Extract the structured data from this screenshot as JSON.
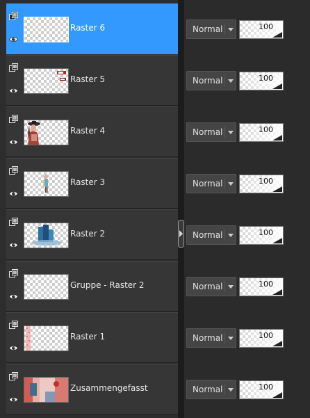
{
  "layers": [
    {
      "name": "Raster 6",
      "blend_mode": "Normal",
      "opacity": "100",
      "selected": true,
      "thumb": "empty"
    },
    {
      "name": "Raster 5",
      "blend_mode": "Normal",
      "opacity": "100",
      "selected": false,
      "thumb": "tag"
    },
    {
      "name": "Raster 4",
      "blend_mode": "Normal",
      "opacity": "100",
      "selected": false,
      "thumb": "woman"
    },
    {
      "name": "Raster 3",
      "blend_mode": "Normal",
      "opacity": "100",
      "selected": false,
      "thumb": "figure"
    },
    {
      "name": "Raster 2",
      "blend_mode": "Normal",
      "opacity": "100",
      "selected": false,
      "thumb": "building"
    },
    {
      "name": "Gruppe - Raster 2",
      "blend_mode": "Normal",
      "opacity": "100",
      "selected": false,
      "thumb": "empty"
    },
    {
      "name": "Raster 1",
      "blend_mode": "Normal",
      "opacity": "100",
      "selected": false,
      "thumb": "stripe"
    },
    {
      "name": "Zusammengefasst",
      "blend_mode": "Normal",
      "opacity": "100",
      "selected": false,
      "thumb": "merged"
    }
  ],
  "colors": {
    "selected": "#3399ff",
    "row": "#363636",
    "background": "#2b2b2b"
  },
  "icons": {
    "layer_type": "layer-stack-icon",
    "visibility": "eye-icon",
    "blend_dropdown": "chevron-down-icon",
    "splitter": "chevron-right-icon"
  }
}
